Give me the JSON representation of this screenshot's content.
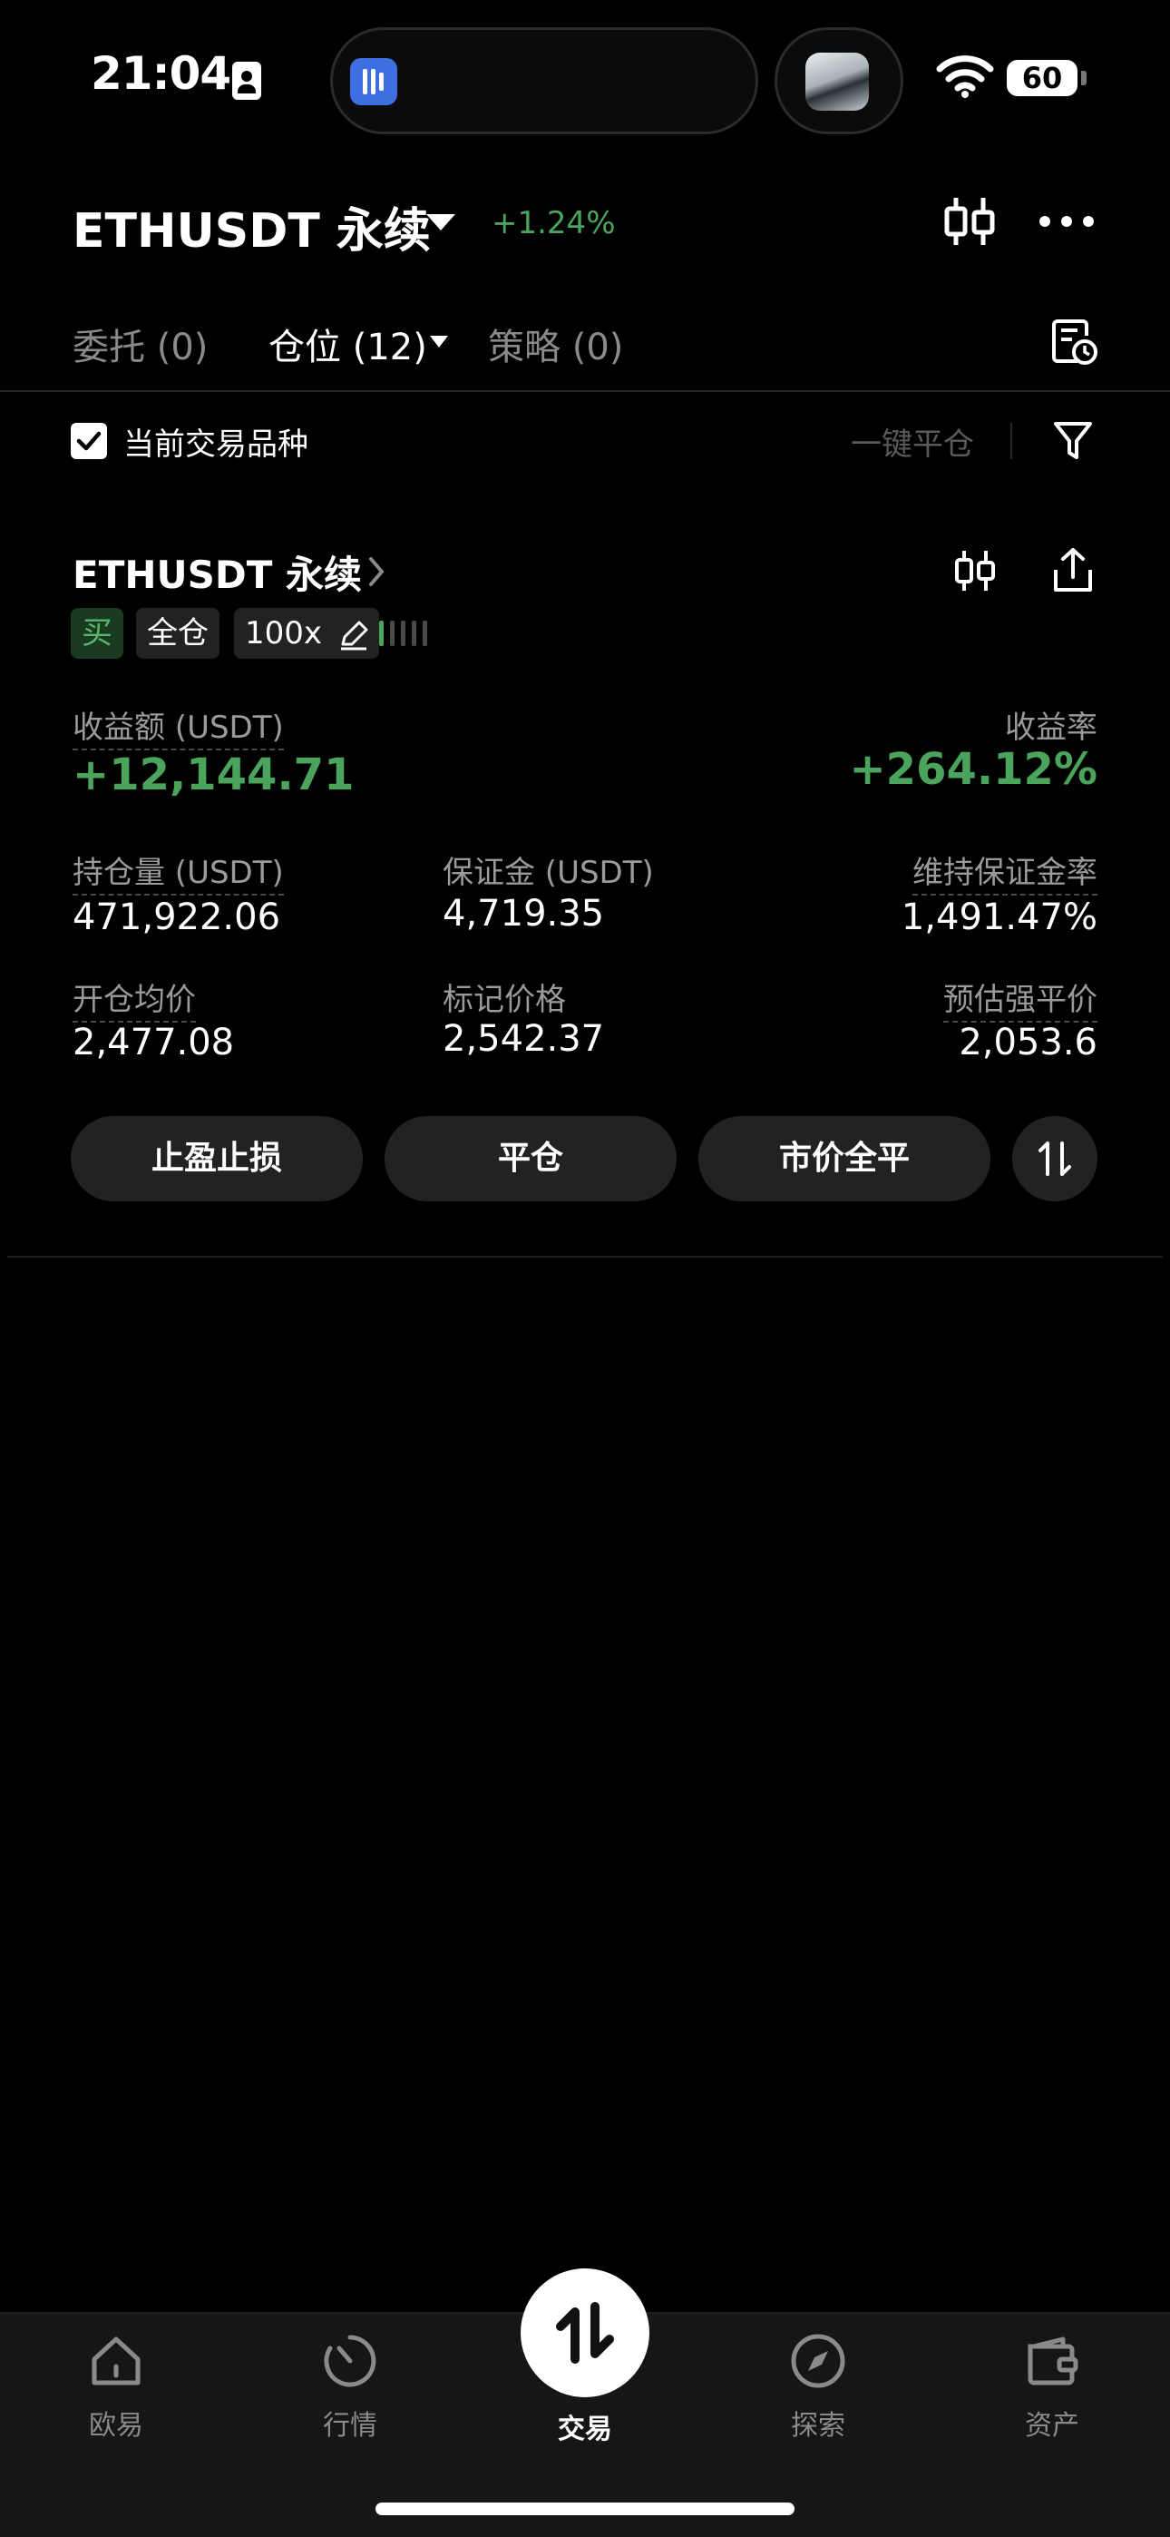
{
  "status_bar": {
    "time": "21:04",
    "battery": "60"
  },
  "header": {
    "title": "ETHUSDT 永续",
    "change": "+1.24%",
    "change_color": "#4aa45c"
  },
  "tabs": [
    {
      "label": "委托 (0)",
      "active": false
    },
    {
      "label": "仓位 (12)",
      "active": true
    },
    {
      "label": "策略 (0)",
      "active": false
    }
  ],
  "filter": {
    "current_symbol_label": "当前交易品种",
    "current_symbol_checked": true,
    "close_all_label": "一键平仓"
  },
  "position": {
    "symbol": "ETHUSDT 永续",
    "tags": {
      "side": "买",
      "margin_mode": "全仓",
      "leverage": "100x"
    },
    "risk_level": 1,
    "pnl": {
      "label": "收益额 (USDT)",
      "value": "+12,144.71"
    },
    "roe": {
      "label": "收益率",
      "value": "+264.12%"
    },
    "size": {
      "label": "持仓量 (USDT)",
      "value": "471,922.06"
    },
    "margin": {
      "label": "保证金 (USDT)",
      "value": "4,719.35"
    },
    "maint_margin_ratio": {
      "label": "维持保证金率",
      "value": "1,491.47%"
    },
    "entry_price": {
      "label": "开仓均价",
      "value": "2,477.08"
    },
    "mark_price": {
      "label": "标记价格",
      "value": "2,542.37"
    },
    "liq_price": {
      "label": "预估强平价",
      "value": "2,053.6"
    },
    "buttons": {
      "tp_sl": "止盈止损",
      "close": "平仓",
      "market_close": "市价全平"
    }
  },
  "bottom_nav": [
    {
      "label": "欧易",
      "icon": "home-icon"
    },
    {
      "label": "行情",
      "icon": "markets-icon"
    },
    {
      "label": "交易",
      "icon": "trade-swap-icon",
      "active": true
    },
    {
      "label": "探索",
      "icon": "compass-icon"
    },
    {
      "label": "资产",
      "icon": "wallet-icon"
    }
  ],
  "colors": {
    "positive": "#4aa45c",
    "background": "#000000",
    "card_button": "#222222"
  }
}
